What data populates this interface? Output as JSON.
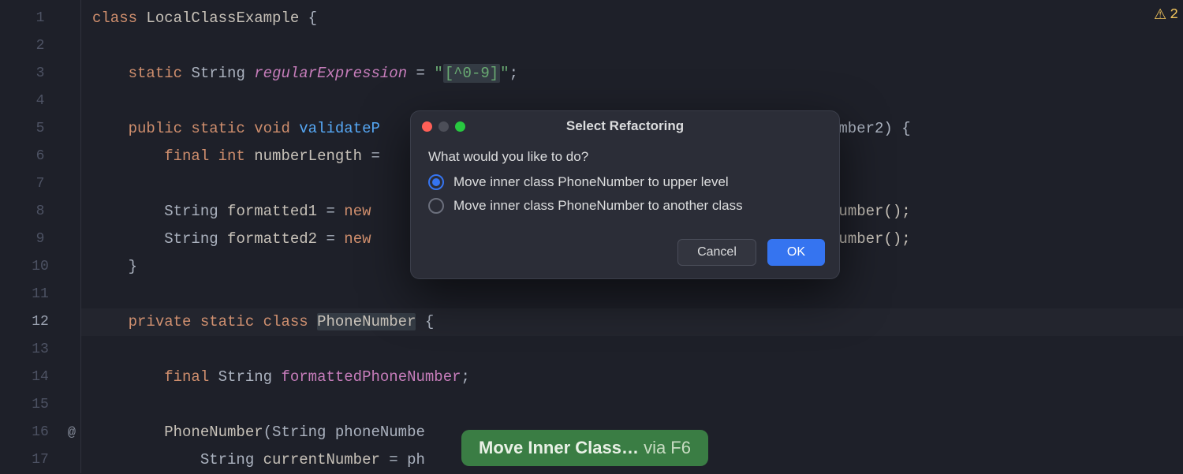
{
  "gutter": {
    "lines": [
      "1",
      "2",
      "3",
      "4",
      "5",
      "6",
      "7",
      "8",
      "9",
      "10",
      "11",
      "12",
      "13",
      "14",
      "15",
      "16",
      "17"
    ],
    "activeLine": "12",
    "iconLine": "16",
    "iconGlyph": "@"
  },
  "code": {
    "l1": {
      "kw": "class",
      "name": "LocalClassExample",
      "br": " {"
    },
    "l3": {
      "mod": "static",
      "type": "String",
      "field": "regularExpression",
      "eq": " = ",
      "q1": "\"",
      "lit": "[^0-9]",
      "q2": "\"",
      ";": ";"
    },
    "l5": {
      "mods": "public static void",
      "fn": "validateP",
      "tail": "Number2) {"
    },
    "l6": {
      "mods": "final int",
      "id": "numberLength",
      "eq": " ="
    },
    "l8": {
      "type": "String",
      "id": "formatted1",
      "eq": " = ",
      "kw": "new",
      "tail": "umber();"
    },
    "l9": {
      "type": "String",
      "id": "formatted2",
      "eq": " = ",
      "kw": "new",
      "tail": "umber();"
    },
    "l10": {
      "br": "}"
    },
    "l12": {
      "mods": "private static class",
      "cls": "PhoneNumber",
      "br": " {"
    },
    "l14": {
      "mods": "final",
      "type": "String",
      "id": "formattedPhoneNumber",
      ";": ";"
    },
    "l16": {
      "ctor": "PhoneNumber",
      "sig": "(String phoneNumbe"
    },
    "l17": {
      "type": "String",
      "id": "currentNumber",
      "eq": " = ph"
    }
  },
  "warning": {
    "glyph": "⚠",
    "count": "2"
  },
  "dialog": {
    "title": "Select Refactoring",
    "prompt": "What would you like to do?",
    "option1": "Move inner class PhoneNumber to upper level",
    "option2": "Move inner class PhoneNumber to another class",
    "cancel": "Cancel",
    "ok": "OK"
  },
  "tooltip": {
    "main": "Move Inner Class…",
    "sub": " via F6"
  }
}
